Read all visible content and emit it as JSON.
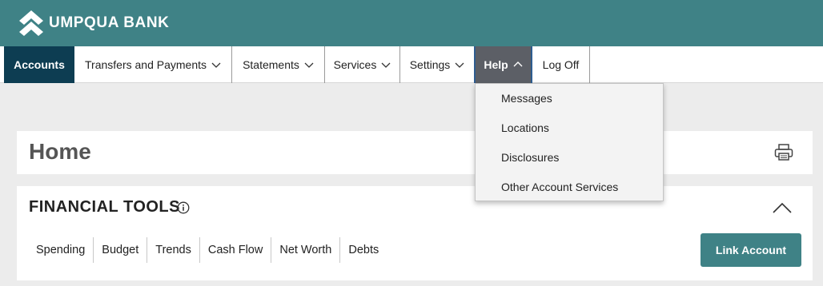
{
  "brand": {
    "name": "UMPQUA BANK",
    "logo_icon": "umpqua-chevron-logo"
  },
  "nav": {
    "accounts": "Accounts",
    "transfers": "Transfers and Payments",
    "statements": "Statements",
    "services": "Services",
    "settings": "Settings",
    "help": "Help",
    "logoff": "Log Off"
  },
  "help_menu": {
    "items": [
      "Messages",
      "Locations",
      "Disclosures",
      "Other Account Services"
    ]
  },
  "home": {
    "title": "Home",
    "print_icon": "printer-icon"
  },
  "financial_tools": {
    "title": "FINANCIAL TOOLS",
    "tabs": [
      "Spending",
      "Budget",
      "Trends",
      "Cash Flow",
      "Net Worth",
      "Debts"
    ],
    "link_button": "Link Account"
  },
  "colors": {
    "header": "#3f8286",
    "accounts_tab": "#0d3d52",
    "help_tab": "#5c5f66",
    "button": "#3f8286"
  }
}
